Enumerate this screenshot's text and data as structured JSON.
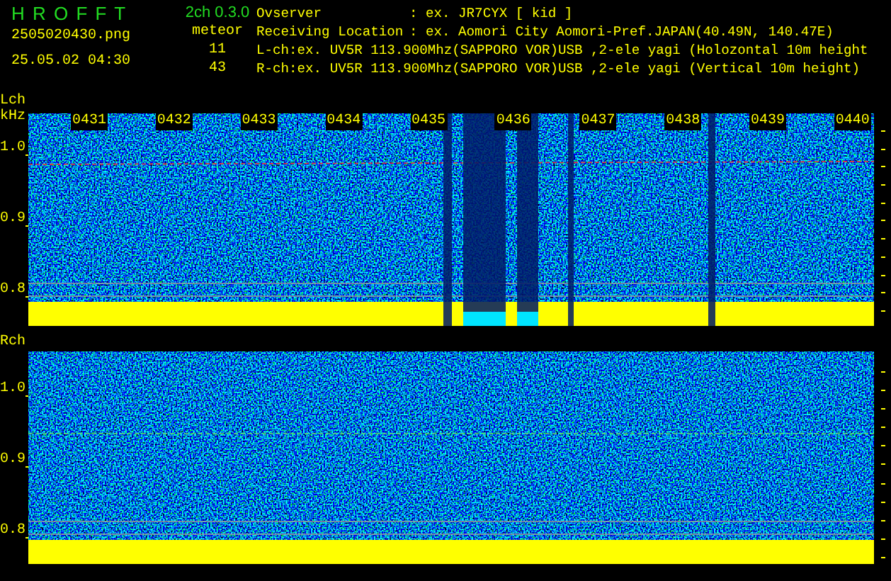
{
  "app": {
    "name": "H R O F F T",
    "version": "2ch 0.3.0"
  },
  "file": {
    "name": "2505020430.png",
    "datetime": "25.05.02 04:30"
  },
  "meteor": {
    "label": "meteor",
    "counts": [
      "11",
      "43"
    ]
  },
  "info": [
    {
      "label": "Ovserver",
      "value": ": ex. JR7CYX [ kid ]"
    },
    {
      "label": "Receiving Location",
      "value": ": ex. Aomori City Aomori-Pref.JAPAN(40.49N, 140.47E)"
    },
    {
      "label": "L-ch:ex. UV5R 113.900Mhz(SAPPORO VOR)USB ,2-ele yagi (Holozontal 10m height"
    },
    {
      "label": "R-ch:ex. UV5R 113.900Mhz(SAPPORO VOR)USB ,2-ele yagi (Vertical 10m height)"
    }
  ],
  "panels": [
    {
      "channel": "Lch",
      "unit": "kHz",
      "time_labels": [
        "0431",
        "0432",
        "0433",
        "0434",
        "0435",
        "0436",
        "0437",
        "0438",
        "0439",
        "0440"
      ],
      "yticks": [
        "1.0",
        "0.9",
        "0.8"
      ]
    },
    {
      "channel": "Rch",
      "yticks": [
        "1.0",
        "0.9",
        "0.8"
      ]
    }
  ]
}
